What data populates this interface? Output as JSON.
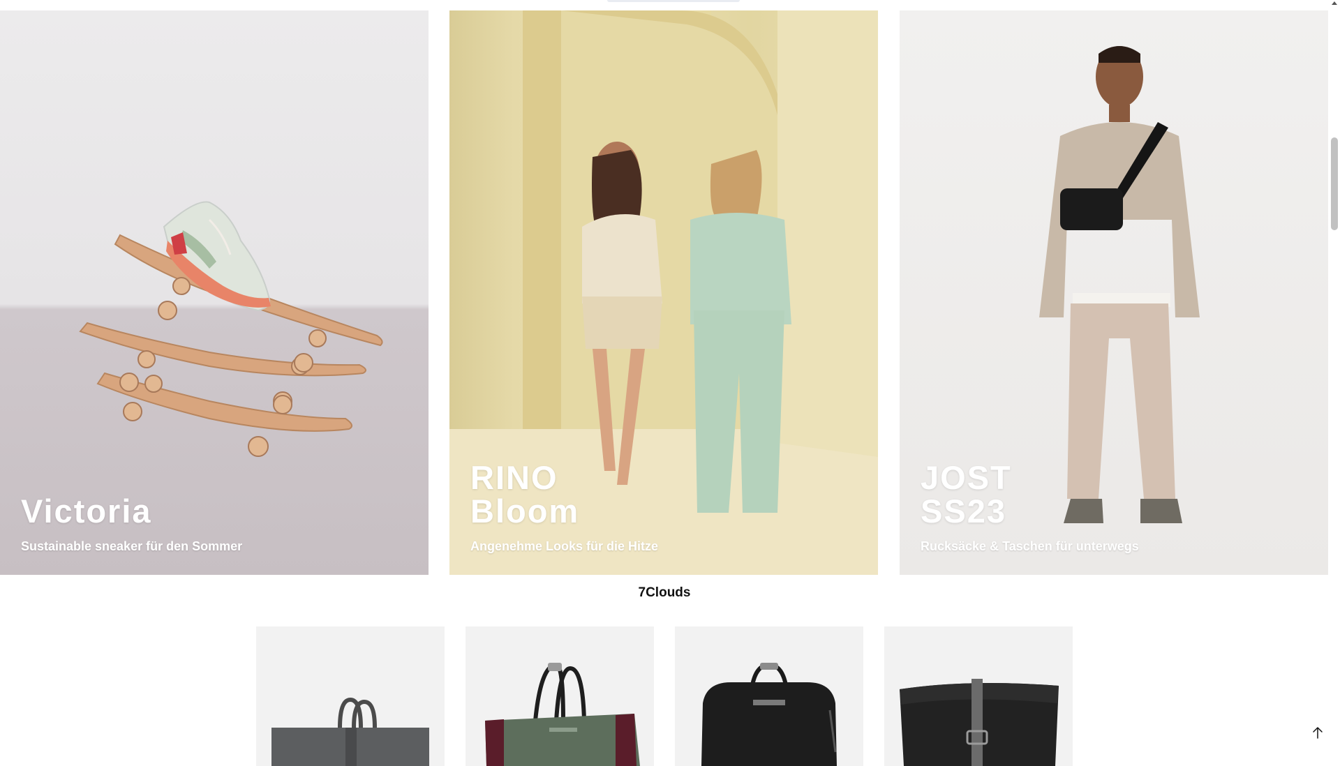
{
  "promos": [
    {
      "title_line1": "Victoria",
      "title_line2": "",
      "subtitle": "Sustainable sneaker für den Sommer"
    },
    {
      "title_line1": "RINO",
      "title_line2": "Bloom",
      "subtitle": "Angenehme Looks für die Hitze"
    },
    {
      "title_line1": "JOST",
      "title_line2": "SS23",
      "subtitle": "Rucksäcke & Taschen für unterwegs"
    }
  ],
  "brand_heading": "7Clouds",
  "products": [
    {
      "name": "grey-tote-bag"
    },
    {
      "name": "green-burgundy-bag"
    },
    {
      "name": "black-leather-backpack"
    },
    {
      "name": "black-rolltop-backpack"
    }
  ],
  "icons": {
    "back_to_top": "arrow-up-icon",
    "scroll_up": "scroll-up-arrow-icon"
  },
  "colors": {
    "caption_text": "#ffffff",
    "product_bg": "#f2f2f2",
    "scroll_thumb": "#c1c1c1"
  }
}
